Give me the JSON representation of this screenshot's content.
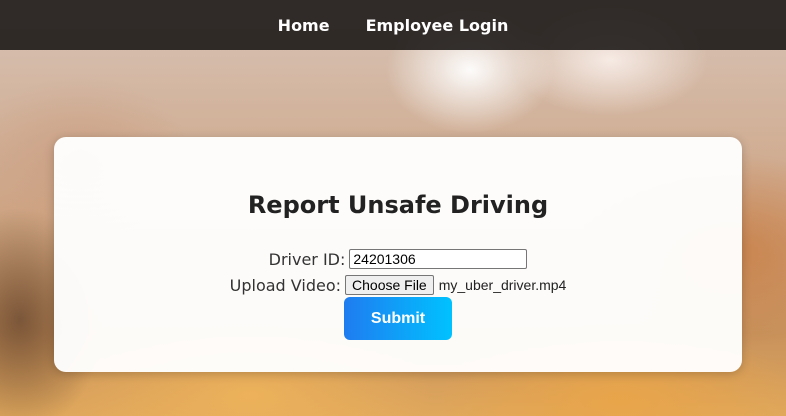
{
  "nav": {
    "items": [
      {
        "label": "Home"
      },
      {
        "label": "Employee Login"
      }
    ]
  },
  "form": {
    "title": "Report Unsafe Driving",
    "driver_id_label": "Driver ID:",
    "driver_id_value": "24201306",
    "upload_label": "Upload Video:",
    "file_button_label": "Choose File",
    "file_name": "my_uber_driver.mp4",
    "submit_label": "Submit"
  },
  "colors": {
    "navbar": "#191614",
    "submit_start": "#1f7cf0",
    "submit_end": "#00c2ff",
    "card": "#ffffff"
  }
}
